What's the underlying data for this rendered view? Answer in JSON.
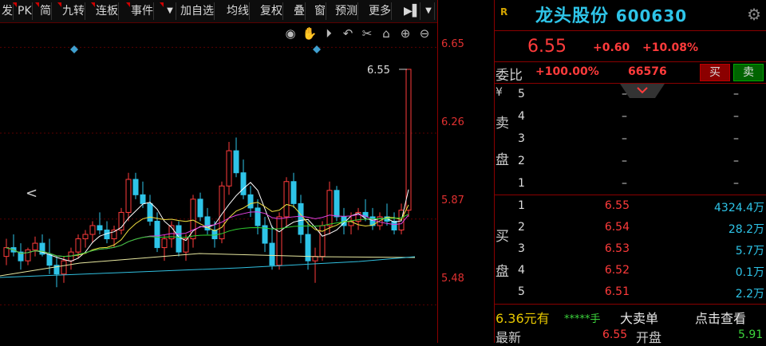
{
  "toolbar": {
    "items": [
      "发",
      "PK",
      "简",
      "九转",
      "连板",
      "事件"
    ],
    "items2": [
      "加自选",
      "均线",
      "复权",
      "叠",
      "窗",
      "预测",
      "更多"
    ],
    "more_icon": "expand-icon",
    "dropdown_icon": "chevron-down-icon"
  },
  "chart_icons": [
    "eye-icon",
    "hand-icon",
    "play-icon",
    "undo-icon",
    "scissors-icon",
    "lock-icon",
    "zoom-in-icon",
    "zoom-out-icon"
  ],
  "chart": {
    "price_axis": [
      "6.65",
      "6.26",
      "5.87",
      "5.48"
    ],
    "last_price_label": "6.55",
    "nav_left": "<"
  },
  "chart_data": {
    "type": "candlestick",
    "ylim": [
      5.38,
      6.72
    ],
    "candles": [
      [
        5.7,
        5.78,
        5.66,
        5.74
      ],
      [
        5.74,
        5.8,
        5.7,
        5.72
      ],
      [
        5.72,
        5.76,
        5.64,
        5.68
      ],
      [
        5.68,
        5.74,
        5.66,
        5.73
      ],
      [
        5.73,
        5.79,
        5.7,
        5.76
      ],
      [
        5.76,
        5.8,
        5.7,
        5.71
      ],
      [
        5.71,
        5.78,
        5.62,
        5.66
      ],
      [
        5.66,
        5.7,
        5.56,
        5.62
      ],
      [
        5.62,
        5.7,
        5.58,
        5.68
      ],
      [
        5.68,
        5.74,
        5.64,
        5.72
      ],
      [
        5.72,
        5.8,
        5.69,
        5.78
      ],
      [
        5.78,
        5.82,
        5.74,
        5.8
      ],
      [
        5.8,
        5.86,
        5.76,
        5.84
      ],
      [
        5.84,
        5.9,
        5.8,
        5.82
      ],
      [
        5.82,
        5.86,
        5.76,
        5.78
      ],
      [
        5.78,
        5.84,
        5.74,
        5.82
      ],
      [
        5.82,
        5.92,
        5.8,
        5.9
      ],
      [
        5.9,
        6.08,
        5.86,
        6.05
      ],
      [
        6.05,
        6.08,
        5.96,
        5.98
      ],
      [
        5.98,
        6.04,
        5.92,
        5.94
      ],
      [
        5.94,
        5.98,
        5.84,
        5.86
      ],
      [
        5.86,
        5.9,
        5.72,
        5.74
      ],
      [
        5.74,
        5.8,
        5.68,
        5.78
      ],
      [
        5.78,
        5.86,
        5.74,
        5.84
      ],
      [
        5.84,
        5.86,
        5.7,
        5.72
      ],
      [
        5.72,
        5.8,
        5.68,
        5.78
      ],
      [
        5.78,
        5.98,
        5.74,
        5.96
      ],
      [
        5.96,
        5.99,
        5.86,
        5.88
      ],
      [
        5.88,
        5.92,
        5.8,
        5.82
      ],
      [
        5.82,
        5.86,
        5.74,
        5.78
      ],
      [
        5.78,
        6.04,
        5.76,
        6.02
      ],
      [
        6.02,
        6.22,
        5.98,
        6.18
      ],
      [
        6.18,
        6.24,
        6.06,
        6.08
      ],
      [
        6.08,
        6.14,
        5.96,
        5.98
      ],
      [
        5.98,
        6.02,
        5.88,
        5.92
      ],
      [
        5.92,
        5.96,
        5.8,
        5.84
      ],
      [
        5.84,
        5.88,
        5.72,
        5.76
      ],
      [
        5.76,
        5.84,
        5.64,
        5.66
      ],
      [
        5.66,
        5.9,
        5.64,
        5.88
      ],
      [
        5.88,
        6.06,
        5.84,
        6.04
      ],
      [
        6.04,
        6.08,
        5.92,
        5.94
      ],
      [
        5.94,
        5.98,
        5.76,
        5.8
      ],
      [
        5.8,
        5.86,
        5.64,
        5.68
      ],
      [
        5.68,
        5.74,
        5.58,
        5.7
      ],
      [
        5.7,
        5.86,
        5.68,
        5.84
      ],
      [
        5.84,
        6.04,
        5.8,
        6.0
      ],
      [
        6.0,
        6.02,
        5.86,
        5.88
      ],
      [
        5.88,
        5.92,
        5.8,
        5.84
      ],
      [
        5.84,
        5.9,
        5.8,
        5.86
      ],
      [
        5.86,
        5.92,
        5.82,
        5.9
      ],
      [
        5.9,
        5.96,
        5.86,
        5.88
      ],
      [
        5.88,
        5.92,
        5.82,
        5.84
      ],
      [
        5.84,
        5.9,
        5.82,
        5.88
      ],
      [
        5.88,
        5.94,
        5.84,
        5.86
      ],
      [
        5.86,
        5.9,
        5.8,
        5.82
      ],
      [
        5.82,
        5.94,
        5.8,
        5.91
      ],
      [
        5.91,
        6.55,
        5.88,
        6.55
      ]
    ]
  },
  "stock": {
    "r_badge": "R",
    "name": "龙头股份",
    "code": "600630",
    "price": "6.55",
    "change": "+0.60",
    "change_pct": "+10.08%"
  },
  "weibi": {
    "label": "委比",
    "pct": "+100.00%",
    "value": "66576",
    "buy_label": "买",
    "sell_label": "卖"
  },
  "sell_side": {
    "label_chars": [
      "¥",
      "卖",
      "盘"
    ],
    "rows": [
      {
        "n": "5",
        "price": "–",
        "vol": "–"
      },
      {
        "n": "4",
        "price": "–",
        "vol": "–"
      },
      {
        "n": "3",
        "price": "–",
        "vol": "–"
      },
      {
        "n": "2",
        "price": "–",
        "vol": "–"
      },
      {
        "n": "1",
        "price": "–",
        "vol": "–"
      }
    ]
  },
  "buy_side": {
    "label_chars": [
      "买",
      "盘"
    ],
    "rows": [
      {
        "n": "1",
        "price": "6.55",
        "vol": "4324.4万"
      },
      {
        "n": "2",
        "price": "6.54",
        "vol": "28.2万"
      },
      {
        "n": "3",
        "price": "6.53",
        "vol": "5.7万"
      },
      {
        "n": "4",
        "price": "6.52",
        "vol": "0.1万"
      },
      {
        "n": "5",
        "price": "6.51",
        "vol": "2.2万"
      }
    ]
  },
  "footer": {
    "left_price": "6.36元有",
    "stars": "*****手",
    "big_sell": "大卖单",
    "view": "点击查看",
    "latest_label": "最新",
    "latest_val": "6.55",
    "open_label": "开盘",
    "open_val": "5.91"
  },
  "colors": {
    "up": "#ff3b3b",
    "down": "#2ec4e8",
    "axis": "#8b0000"
  }
}
